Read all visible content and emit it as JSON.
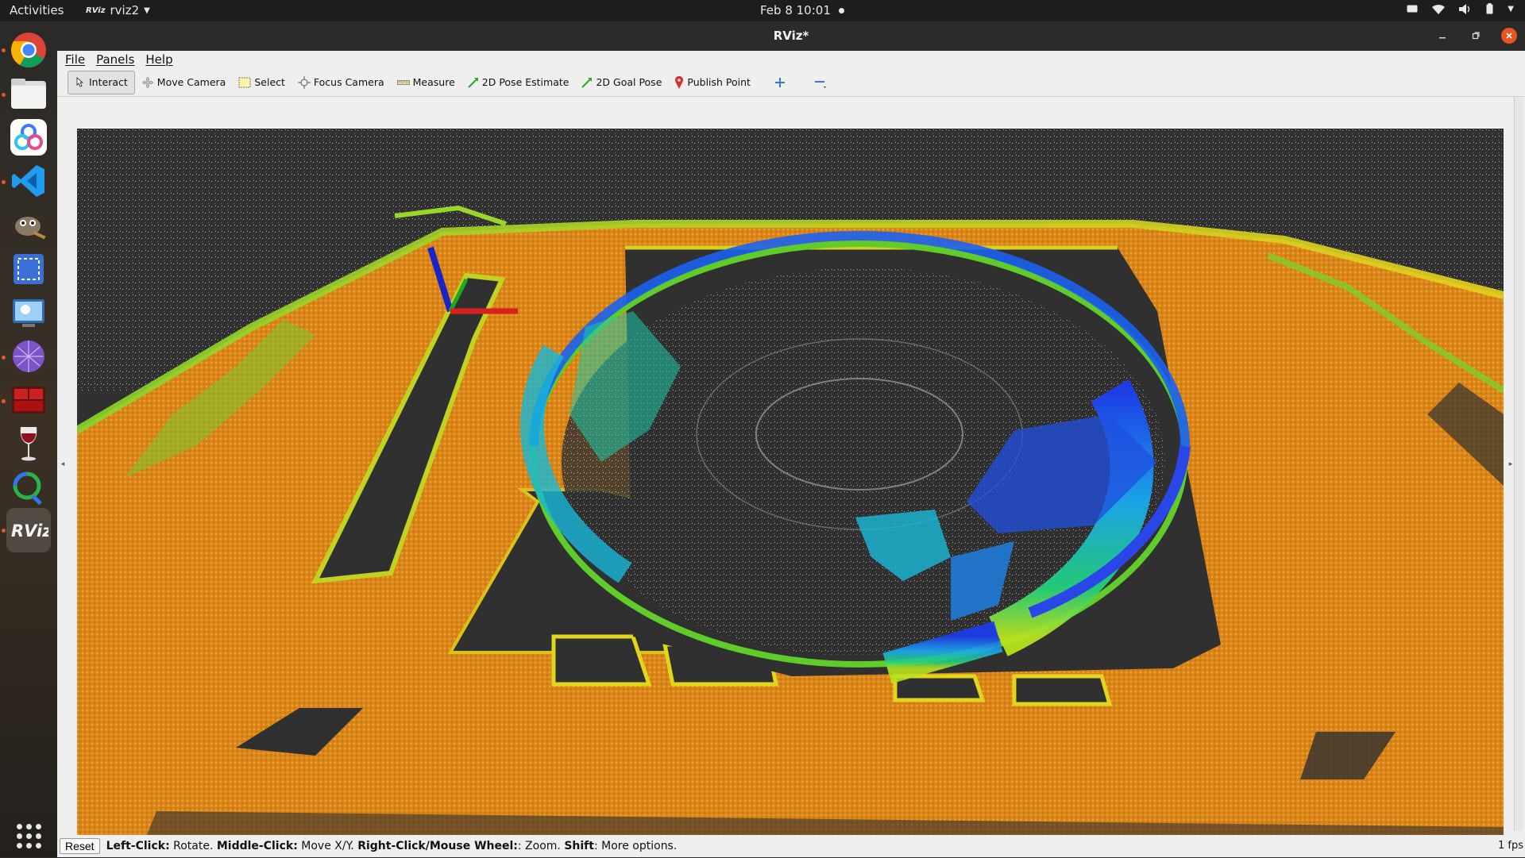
{
  "topbar": {
    "activities": "Activities",
    "app_name": "rviz2",
    "app_badge": "RViz",
    "clock": "Feb 8  10:01"
  },
  "window": {
    "title": "RViz*"
  },
  "menubar": {
    "items": [
      "File",
      "Panels",
      "Help"
    ]
  },
  "toolbar": {
    "tools": [
      {
        "label": "Interact",
        "icon": "interact-cursor-icon",
        "checked": true
      },
      {
        "label": "Move Camera",
        "icon": "move-camera-icon"
      },
      {
        "label": "Select",
        "icon": "select-box-icon"
      },
      {
        "label": "Focus Camera",
        "icon": "focus-camera-icon"
      },
      {
        "label": "Measure",
        "icon": "ruler-icon"
      },
      {
        "label": "2D Pose Estimate",
        "icon": "green-arrow-icon"
      },
      {
        "label": "2D Goal Pose",
        "icon": "green-arrow-icon"
      },
      {
        "label": "Publish Point",
        "icon": "map-pin-icon"
      }
    ]
  },
  "statusbar": {
    "reset_label": "Reset",
    "hint_parts": [
      {
        "bold": "Left-Click:",
        "text": " Rotate. "
      },
      {
        "bold": "Middle-Click:",
        "text": " Move X/Y. "
      },
      {
        "bold": "Right-Click/Mouse Wheel:",
        "text": ": Zoom. "
      },
      {
        "bold": "Shift",
        "text": ": More options."
      }
    ],
    "fps": "1 fps"
  },
  "dock": {
    "apps": [
      "chrome-icon",
      "files-icon",
      "baidu-netdisk-icon",
      "vscode-icon",
      "gimp-icon",
      "screenshot-icon",
      "system-monitor-icon",
      "stellarium-icon",
      "terminator-icon",
      "wine-icon",
      "qt-creator-icon",
      "rviz-icon",
      "show-applications-icon"
    ]
  },
  "colors": {
    "accent": "#e95420",
    "ground_orange": "#e08a1c",
    "background_render": "#303030"
  }
}
